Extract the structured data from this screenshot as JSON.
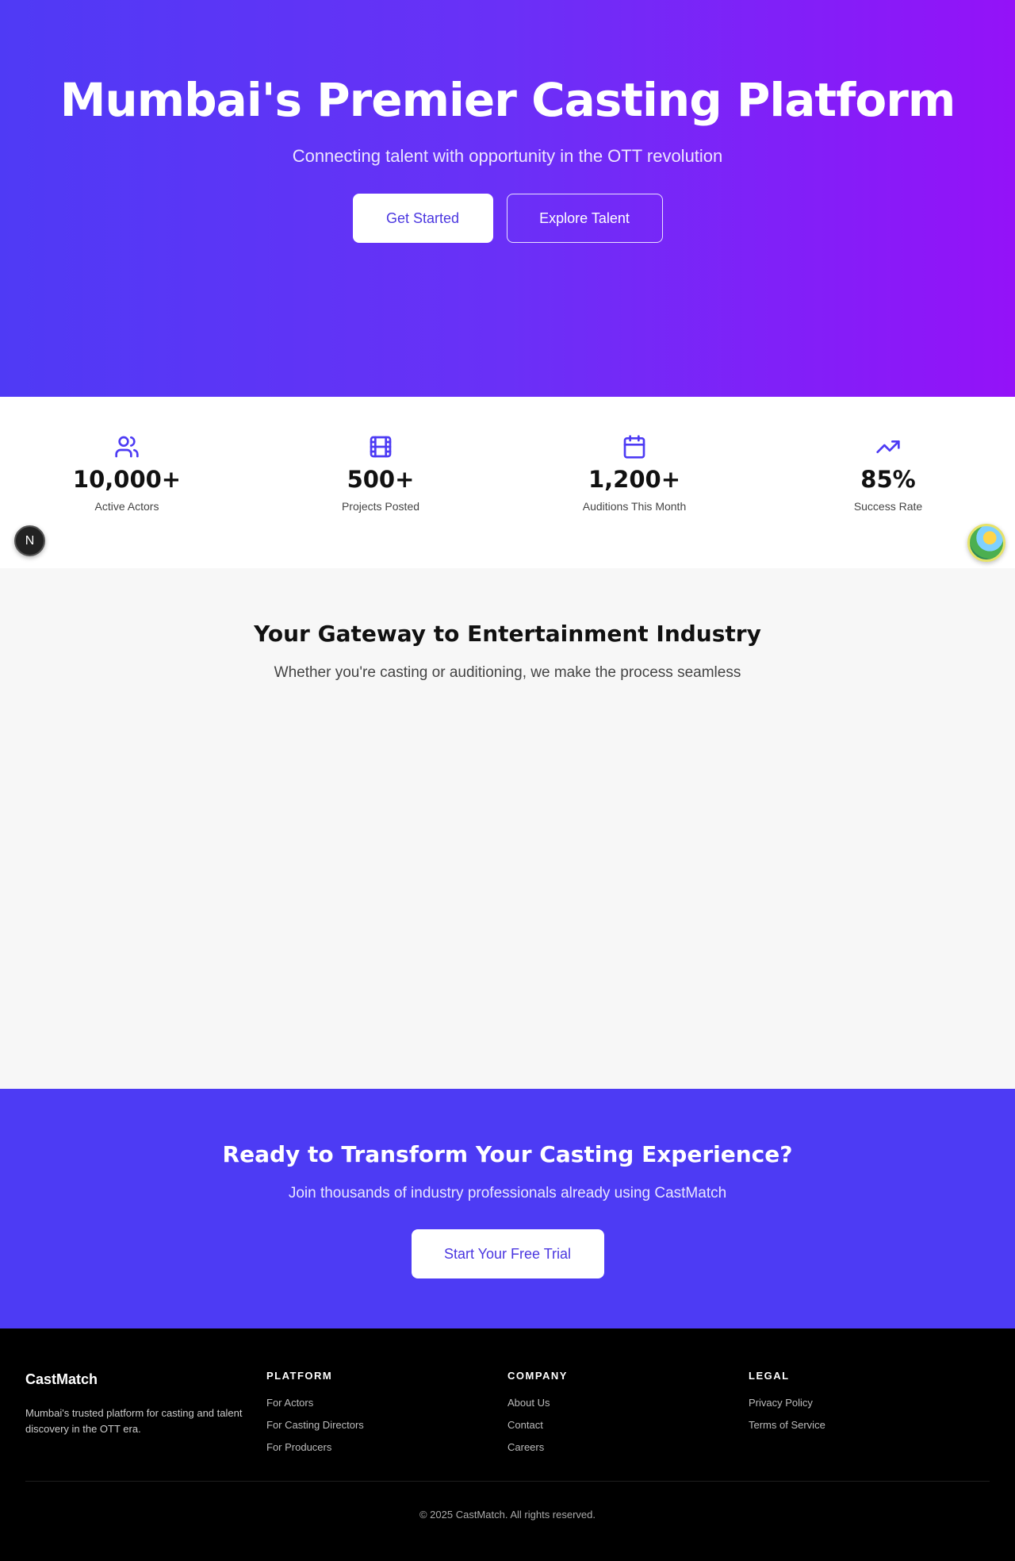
{
  "hero": {
    "title": "Mumbai's Premier Casting Platform",
    "subtitle": "Connecting talent with opportunity in the OTT revolution",
    "primary_button": "Get Started",
    "secondary_button": "Explore Talent"
  },
  "stats": [
    {
      "icon": "users-icon",
      "value": "10,000+",
      "label": "Active Actors"
    },
    {
      "icon": "film-icon",
      "value": "500+",
      "label": "Projects Posted"
    },
    {
      "icon": "calendar-icon",
      "value": "1,200+",
      "label": "Auditions This Month"
    },
    {
      "icon": "trending-up-icon",
      "value": "85%",
      "label": "Success Rate"
    }
  ],
  "floating": {
    "dev_badge": "N"
  },
  "gateway": {
    "title": "Your Gateway to Entertainment Industry",
    "subtitle": "Whether you're casting or auditioning, we make the process seamless"
  },
  "cta": {
    "title": "Ready to Transform Your Casting Experience?",
    "subtitle": "Join thousands of industry professionals already using CastMatch",
    "button": "Start Your Free Trial"
  },
  "footer": {
    "brand": "CastMatch",
    "description": "Mumbai's trusted platform for casting and talent discovery in the OTT era.",
    "platform": {
      "heading": "PLATFORM",
      "links": [
        "For Actors",
        "For Casting Directors",
        "For Producers"
      ]
    },
    "company": {
      "heading": "COMPANY",
      "links": [
        "About Us",
        "Contact",
        "Careers"
      ]
    },
    "legal": {
      "heading": "LEGAL",
      "links": [
        "Privacy Policy",
        "Terms of Service"
      ]
    },
    "copyright": "© 2025 CastMatch. All rights reserved."
  },
  "colors": {
    "accent": "#4d3bf4",
    "gradient_start": "#4f3af5",
    "gradient_end": "#9412f8",
    "footer_bg": "#000000"
  }
}
